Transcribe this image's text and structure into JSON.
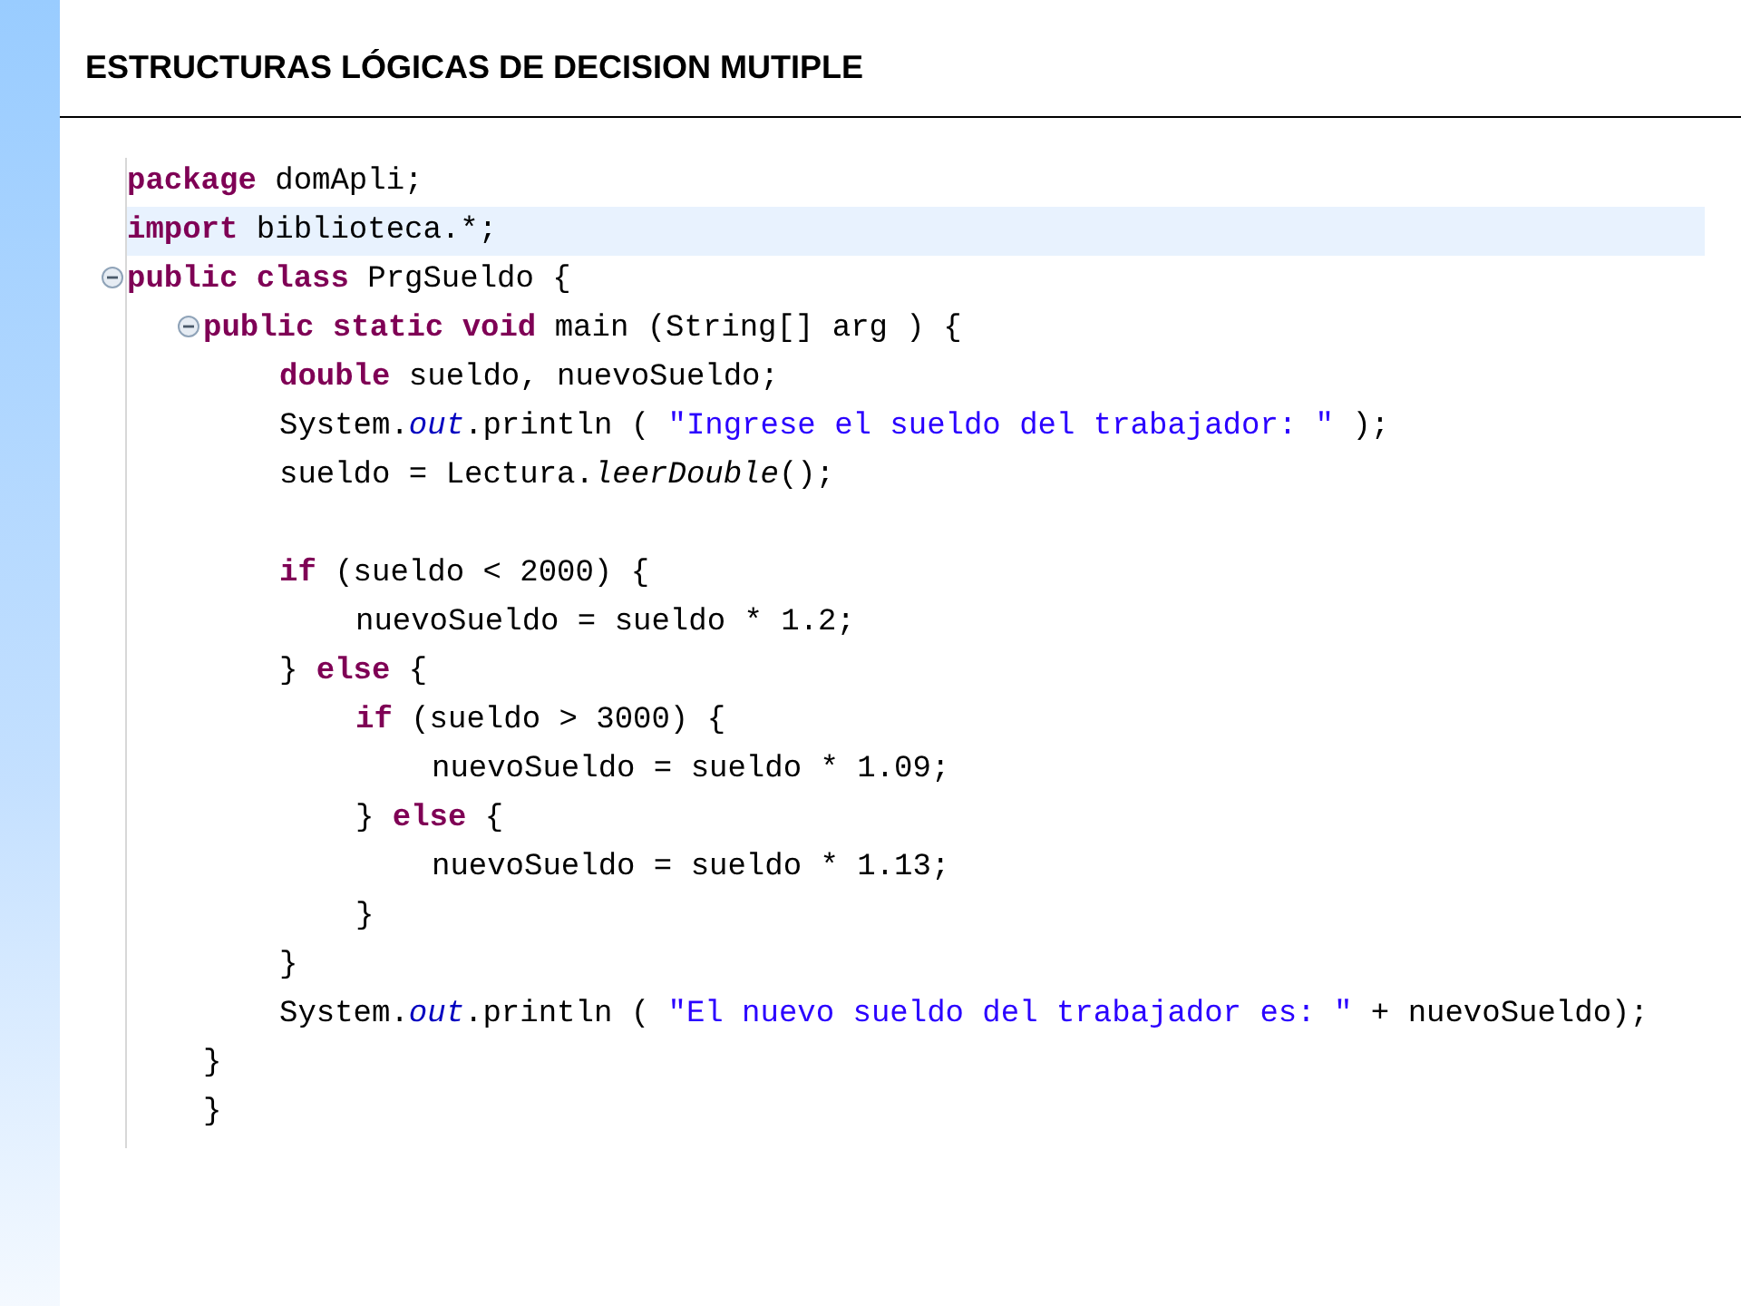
{
  "slide": {
    "title": "ESTRUCTURAS LÓGICAS DE DECISION MUTIPLE"
  },
  "editor": {
    "lines": [
      {
        "kind": "code",
        "current": false,
        "tokens": [
          {
            "kind": "keyword",
            "text": "package"
          },
          {
            "kind": "plain",
            "text": " domApli;"
          }
        ]
      },
      {
        "kind": "code",
        "current": true,
        "tokens": [
          {
            "kind": "keyword",
            "text": "import"
          },
          {
            "kind": "plain",
            "text": " biblioteca.*;"
          }
        ]
      },
      {
        "kind": "code",
        "current": false,
        "expanded": true,
        "tokens": [
          {
            "kind": "keyword",
            "text": "public class"
          },
          {
            "kind": "plain",
            "text": " PrgSueldo {"
          }
        ],
        "children": [
          {
            "kind": "code",
            "current": false,
            "expanded": true,
            "tokens": [
              {
                "kind": "keyword",
                "text": "public static void"
              },
              {
                "kind": "plain",
                "text": " main (String[] arg ) {"
              }
            ],
            "children": [
              {
                "kind": "code",
                "current": false,
                "tokens": [
                  {
                    "kind": "keyword",
                    "text": "double"
                  },
                  {
                    "kind": "plain",
                    "text": " sueldo, nuevoSueldo;"
                  }
                ]
              },
              {
                "kind": "code",
                "current": false,
                "tokens": [
                  {
                    "kind": "plain",
                    "text": "System."
                  },
                  {
                    "kind": "field",
                    "text": "out"
                  },
                  {
                    "kind": "plain",
                    "text": ".println ( "
                  },
                  {
                    "kind": "string",
                    "text": "\"Ingrese el sueldo del trabajador: \""
                  },
                  {
                    "kind": "plain",
                    "text": " );"
                  }
                ]
              },
              {
                "kind": "code",
                "current": false,
                "tokens": [
                  {
                    "kind": "plain",
                    "text": "sueldo = Lectura."
                  },
                  {
                    "kind": "static_method",
                    "text": "leerDouble"
                  },
                  {
                    "kind": "plain",
                    "text": "();"
                  }
                ]
              },
              {
                "kind": "blank",
                "current": false
              },
              {
                "kind": "code",
                "current": false,
                "tokens": [
                  {
                    "kind": "keyword",
                    "text": "if"
                  },
                  {
                    "kind": "plain",
                    "text": " (sueldo < 2000) {"
                  }
                ],
                "children": [
                  {
                    "kind": "code",
                    "current": false,
                    "tokens": [
                      {
                        "kind": "plain",
                        "text": "nuevoSueldo = sueldo * 1.2;"
                      }
                    ]
                  }
                ]
              },
              {
                "kind": "code",
                "current": false,
                "tokens": [
                  {
                    "kind": "plain",
                    "text": "} "
                  },
                  {
                    "kind": "keyword",
                    "text": "else"
                  },
                  {
                    "kind": "plain",
                    "text": " {"
                  }
                ],
                "children": [
                  {
                    "kind": "code",
                    "current": false,
                    "tokens": [
                      {
                        "kind": "keyword",
                        "text": "if"
                      },
                      {
                        "kind": "plain",
                        "text": " (sueldo > 3000) {"
                      }
                    ],
                    "children": [
                      {
                        "kind": "code",
                        "current": false,
                        "tokens": [
                          {
                            "kind": "plain",
                            "text": "nuevoSueldo = sueldo * 1.09;"
                          }
                        ]
                      }
                    ]
                  },
                  {
                    "kind": "code",
                    "current": false,
                    "tokens": [
                      {
                        "kind": "plain",
                        "text": "} "
                      },
                      {
                        "kind": "keyword",
                        "text": "else"
                      },
                      {
                        "kind": "plain",
                        "text": " {"
                      }
                    ],
                    "children": [
                      {
                        "kind": "code",
                        "current": false,
                        "tokens": [
                          {
                            "kind": "plain",
                            "text": "nuevoSueldo = sueldo * 1.13;"
                          }
                        ]
                      }
                    ]
                  },
                  {
                    "kind": "code",
                    "current": false,
                    "tokens": [
                      {
                        "kind": "plain",
                        "text": "}"
                      }
                    ]
                  }
                ]
              },
              {
                "kind": "code",
                "current": false,
                "tokens": [
                  {
                    "kind": "plain",
                    "text": "}"
                  }
                ]
              },
              {
                "kind": "code",
                "current": false,
                "tokens": [
                  {
                    "kind": "plain",
                    "text": "System."
                  },
                  {
                    "kind": "field",
                    "text": "out"
                  },
                  {
                    "kind": "plain",
                    "text": ".println ( "
                  },
                  {
                    "kind": "string",
                    "text": "\"El nuevo sueldo del trabajador es: \""
                  },
                  {
                    "kind": "plain",
                    "text": " + nuevoSueldo);"
                  }
                ]
              }
            ]
          },
          {
            "kind": "code",
            "current": false,
            "tokens": [
              {
                "kind": "plain",
                "text": "}"
              }
            ]
          },
          {
            "kind": "code",
            "current": false,
            "tokens": [
              {
                "kind": "plain",
                "text": "}"
              }
            ]
          }
        ]
      }
    ]
  }
}
